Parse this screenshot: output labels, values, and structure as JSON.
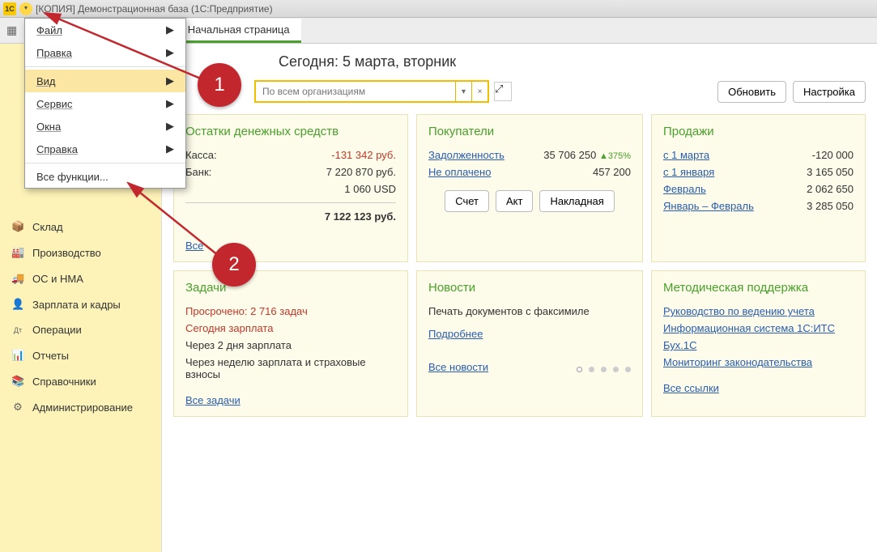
{
  "titlebar": {
    "text": "[КОПИЯ] Демонстрационная база  (1С:Предприятие)",
    "app_icon_label": "1С"
  },
  "toolbar": {
    "tab_label": "Начальная страница"
  },
  "menu": {
    "items": [
      {
        "label": "Файл",
        "has_sub": true
      },
      {
        "label": "Правка",
        "has_sub": true
      },
      {
        "label": "Вид",
        "has_sub": true
      },
      {
        "label": "Сервис",
        "has_sub": true
      },
      {
        "label": "Окна",
        "has_sub": true
      },
      {
        "label": "Справка",
        "has_sub": true
      }
    ],
    "all_functions": "Все функции..."
  },
  "sidebar": {
    "items": [
      {
        "icon": "📦",
        "label": "Склад"
      },
      {
        "icon": "🏭",
        "label": "Производство"
      },
      {
        "icon": "🚚",
        "label": "ОС и НМА"
      },
      {
        "icon": "👤",
        "label": "Зарплата и кадры"
      },
      {
        "icon": "Дт",
        "label": "Операции"
      },
      {
        "icon": "📊",
        "label": "Отчеты"
      },
      {
        "icon": "📚",
        "label": "Справочники"
      },
      {
        "icon": "⚙",
        "label": "Администрирование"
      }
    ]
  },
  "header": {
    "date_title": "Сегодня: 5 марта, вторник",
    "org_placeholder": "По всем организациям",
    "refresh": "Обновить",
    "settings": "Настройка"
  },
  "cash": {
    "title": "Остатки денежных средств",
    "kassa_label": "Касса:",
    "kassa_val": "-131 342 руб.",
    "bank_label": "Банк:",
    "bank_val": "7 220 870 руб.",
    "usd_val": "1 060 USD",
    "total_val": "7 122 123 руб.",
    "all_cash": "Все"
  },
  "buyers": {
    "title": "Покупатели",
    "debt_label": "Задолженность",
    "debt_val": "35 706 250",
    "debt_delta": "▲375%",
    "unpaid_label": "Не оплачено",
    "unpaid_val": "457 200",
    "btn_invoice": "Счет",
    "btn_act": "Акт",
    "btn_nakl": "Накладная"
  },
  "sales": {
    "title": "Продажи",
    "rows": [
      {
        "label": "с 1 марта",
        "val": "-120 000"
      },
      {
        "label": "с 1 января",
        "val": "3 165 050"
      },
      {
        "label": "Февраль",
        "val": "2 062 650"
      },
      {
        "label": "Январь – Февраль",
        "val": "3 285 050"
      }
    ]
  },
  "tasks": {
    "title": "Задачи",
    "overdue": "Просрочено: 2 716 задач",
    "today": "Сегодня зарплата",
    "in2days": "Через 2 дня зарплата",
    "inweek": "Через неделю зарплата и страховые взносы",
    "all": "Все задачи"
  },
  "news": {
    "title": "Новости",
    "line": "Печать документов с факсимиле",
    "more": "Подробнее",
    "all": "Все новости"
  },
  "support": {
    "title": "Методическая поддержка",
    "links": [
      "Руководство по ведению учета",
      "Информационная система 1С:ИТС",
      "Бух.1С",
      "Мониторинг законодательства"
    ],
    "all": "Все ссылки"
  },
  "annot": {
    "b1": "1",
    "b2": "2"
  }
}
